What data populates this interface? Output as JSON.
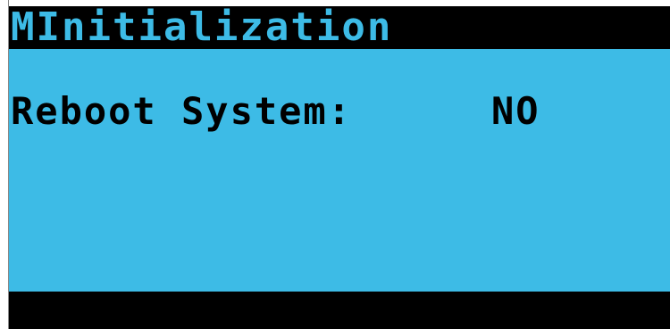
{
  "screen": {
    "title_prefix": "M",
    "title": "Initialization",
    "parameter": {
      "label": "Reboot System:",
      "value": "NO"
    },
    "footer_text": ""
  },
  "colors": {
    "lcd_background": "#3dbbe6",
    "bar_background": "#000000",
    "text": "#000000"
  }
}
